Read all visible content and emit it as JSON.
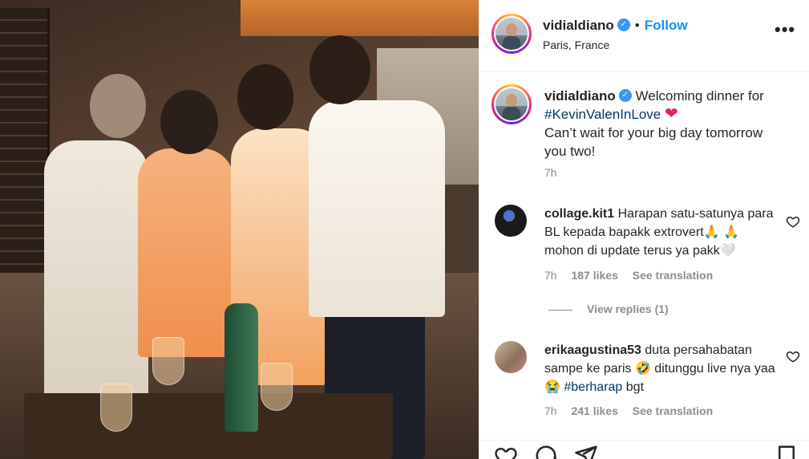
{
  "post": {
    "author": {
      "username": "vidialdiano",
      "verified": true,
      "location": "Paris, France"
    },
    "follow_label": "Follow",
    "separator": "•",
    "more_label": "•••",
    "caption": {
      "username": "vidialdiano",
      "text_before": "Welcoming dinner for",
      "hashtag": "#KevinValenInLove",
      "emoji": "❤",
      "text_after": "Can’t wait for your big day tomorrow you two!",
      "time": "7h"
    },
    "comments": [
      {
        "username": "collage.kit1",
        "text_1": "Harapan satu-satunya para BL kepada bapakk extrovert🙏",
        "text_2": "🙏 mohon di update terus ya pakk🤍",
        "time": "7h",
        "likes": "187 likes",
        "translate": "See translation",
        "replies": "View replies (1)"
      },
      {
        "username": "erikaagustina53",
        "text_1": "duta persahabatan sampe ke paris 🤣 ditunggu live nya yaa 😭",
        "hashtag": "#berharap",
        "text_2": "bgt",
        "time": "7h",
        "likes": "241 likes",
        "translate": "See translation"
      }
    ]
  },
  "icons": [
    "verified-badge-icon",
    "more-options-icon",
    "heart-icon",
    "comment-icon",
    "share-icon",
    "bookmark-icon"
  ],
  "colors": {
    "link": "#0095f6",
    "verified": "#3897f0",
    "heart": "#e0245e",
    "hashtag": "#00376b",
    "muted": "#8e8e8e"
  }
}
